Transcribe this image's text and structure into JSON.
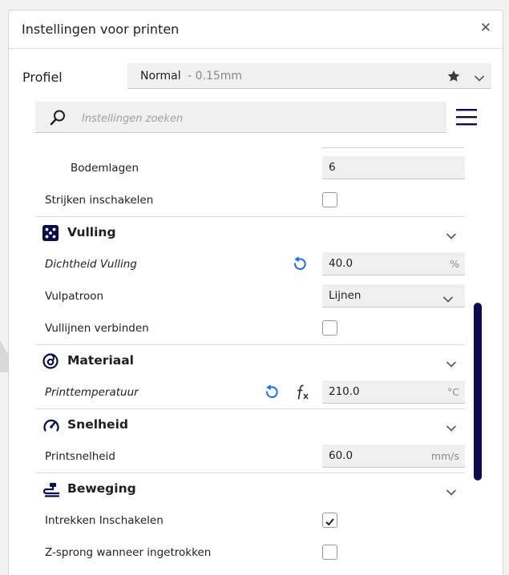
{
  "window": {
    "title": "Instellingen voor printen"
  },
  "profile": {
    "label": "Profiel",
    "name": "Normal",
    "sub": " - 0.15mm"
  },
  "search": {
    "placeholder": "Instellingen zoeken"
  },
  "rows": {
    "bodemlagen": {
      "label": "Bodemlagen",
      "value": "6"
    },
    "strijken": {
      "label": "Strijken inschakelen",
      "checked": false
    },
    "dichtheid": {
      "label": "Dichtheid Vulling",
      "value": "40.0",
      "unit": "%"
    },
    "vulpatroon": {
      "label": "Vulpatroon",
      "value": "Lijnen"
    },
    "vullijnen": {
      "label": "Vullijnen verbinden",
      "checked": false
    },
    "printtemp": {
      "label": "Printtemperatuur",
      "value": "210.0",
      "unit": "°C"
    },
    "printsnelheid": {
      "label": "Printsnelheid",
      "value": "60.0",
      "unit": "mm/s"
    },
    "intrekken": {
      "label": "Intrekken Inschakelen",
      "checked": true
    },
    "zsprong": {
      "label": "Z-sprong wanneer ingetrokken",
      "checked": false
    }
  },
  "categories": {
    "vulling": "Vulling",
    "materiaal": "Materiaal",
    "snelheid": "Snelheid",
    "beweging": "Beweging"
  },
  "colors": {
    "accent": "#196ef0",
    "scrollbar": "#0a0a4e",
    "text": "#1f1f1f"
  },
  "icons": {
    "close": "close-icon",
    "star": "star-icon",
    "search": "search-icon",
    "menu": "hamburger-menu-icon",
    "reset": "reset-icon",
    "formula": "formula-icon",
    "infill": "infill-icon",
    "material": "material-icon",
    "speed": "speed-icon",
    "travel": "travel-icon"
  }
}
